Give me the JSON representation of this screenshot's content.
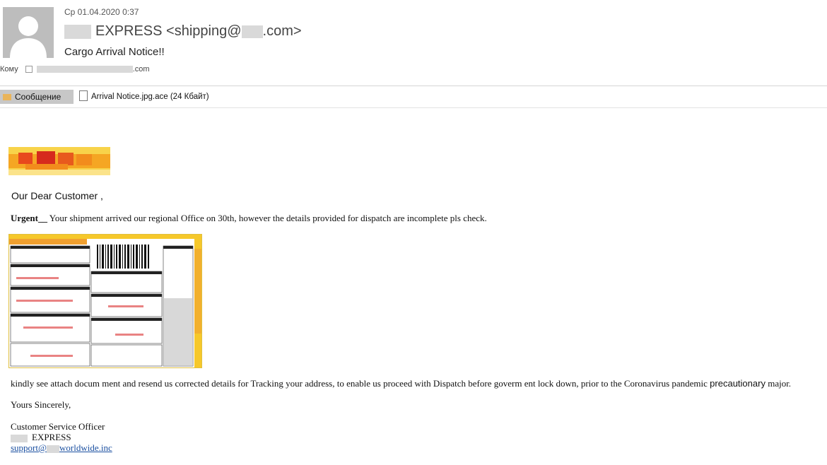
{
  "header": {
    "date": "Ср 01.04.2020 0:37",
    "sender_name": "EXPRESS",
    "sender_email_prefix": "<shipping@",
    "sender_email_suffix": ".com>",
    "subject": "Cargo Arrival Notice!!",
    "to_label": "Кому",
    "to_suffix": ".com"
  },
  "tabs": {
    "message_label": "Сообщение",
    "attachment_label": "Arrival Notice.jpg.ace (24 Кбайт)"
  },
  "body": {
    "greeting": "Our Dear Customer ,",
    "urgent_label": "Urgent__",
    "urgent_text": " Your shipment arrived our regional Office on 30th, however the details provided for dispatch are incomplete pls check.",
    "para_text": "kindly see attach docum ment and resend us corrected details for Tracking your address, to enable us proceed with Dispatch before goverm ent lock down, prior to the Coronavirus pandemic ",
    "para_tail_sans": "precautionary",
    "para_end": " major.",
    "yours": "Yours Sincerely,",
    "sig_title": "Customer Service Officer",
    "sig_company": "EXPRESS",
    "sig_email_prefix": "support@",
    "sig_email_suffix": "worldwide.inc"
  },
  "colors": {
    "accent_link": "#1a4fa0",
    "tab_bg": "#c7c7c7",
    "logo_orange": "#f28c1c",
    "logo_red": "#d62a1d"
  }
}
